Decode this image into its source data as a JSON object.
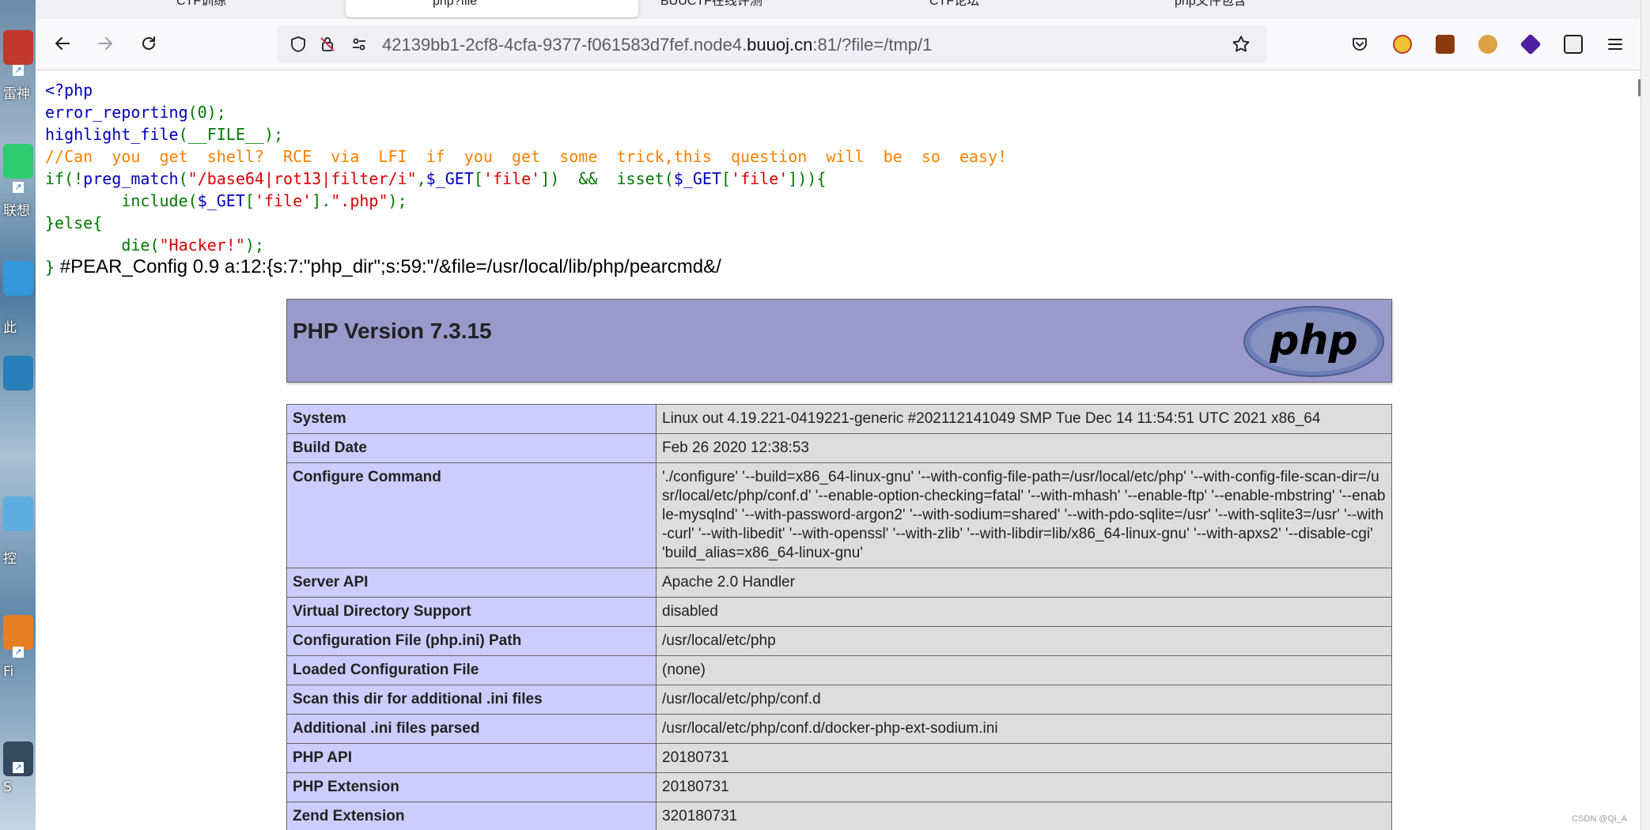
{
  "browser": {
    "tabs": [
      {
        "label": "CTF训练",
        "active": false
      },
      {
        "label": "php?file",
        "active": true
      },
      {
        "label": "BUUCTF在线评测",
        "active": false
      },
      {
        "label": "CTF论坛",
        "active": false
      },
      {
        "label": "php文件包含",
        "active": false
      }
    ],
    "url": {
      "prefix": "42139bb1-2cf8-4cfa-9377-f061583d7fef.node4.",
      "host": "buuoj.cn",
      "suffix": ":81/?file=/tmp/1"
    },
    "icons": {
      "back": "arrow-left-icon",
      "forward": "arrow-right-icon",
      "reload": "reload-icon",
      "shield": "shield-icon",
      "tracking": "tracking-blocked-icon",
      "permissions": "permissions-icon",
      "bookmark": "star-icon",
      "pocket": "pocket-icon",
      "menu": "hamburger-icon"
    }
  },
  "desktop": {
    "labels": [
      "雷神",
      "联想",
      "此",
      "控",
      "Fi",
      "S"
    ]
  },
  "source_code": {
    "line1": "<?php",
    "line2_fn": "error_reporting",
    "line2_rest": "(0);",
    "line3_fn": "highlight_file",
    "line3_rest": "(__FILE__);",
    "line4_comment": "//Can  you  get  shell?  RCE  via  LFI  if  you  get  some  trick,this  question  will  be  so  easy!",
    "line5_if": "if(!",
    "line5_fn": "preg_match",
    "line5_a": "(",
    "line5_pattern": "\"/base64|rot13|filter/i\"",
    "line5_b": ",",
    "line5_var1": "$_GET",
    "line5_c": "[",
    "line5_key1": "'file'",
    "line5_d": "])  &&  ",
    "line5_isset": "isset",
    "line5_e": "(",
    "line5_var2": "$_GET",
    "line5_f": "[",
    "line5_key2": "'file'",
    "line5_g": "])){",
    "line6_indent": "        ",
    "line6_include": "include(",
    "line6_var": "$_GET",
    "line6_a": "[",
    "line6_key": "'file'",
    "line6_b": "].",
    "line6_ext": "\".php\"",
    "line6_c": ");",
    "line7": "}else{",
    "line8_indent": "        ",
    "line8_die": "die(",
    "line8_msg": "\"Hacker!\"",
    "line8_end": ");",
    "line9_brace": "}",
    "line9_pear": " #PEAR_Config 0.9 a:12:{s:7:\"php_dir\";s:59:\"/&file=/usr/local/lib/php/pearcmd&/"
  },
  "phpinfo": {
    "title": "PHP Version 7.3.15",
    "logo_text": "php",
    "rows": [
      {
        "key": "System",
        "value": "Linux out 4.19.221-0419221-generic #202112141049 SMP Tue Dec 14 11:54:51 UTC 2021 x86_64"
      },
      {
        "key": "Build Date",
        "value": "Feb 26 2020 12:38:53"
      },
      {
        "key": "Configure Command",
        "value": "'./configure' '--build=x86_64-linux-gnu' '--with-config-file-path=/usr/local/etc/php' '--with-config-file-scan-dir=/usr/local/etc/php/conf.d' '--enable-option-checking=fatal' '--with-mhash' '--enable-ftp' '--enable-mbstring' '--enable-mysqlnd' '--with-password-argon2' '--with-sodium=shared' '--with-pdo-sqlite=/usr' '--with-sqlite3=/usr' '--with-curl' '--with-libedit' '--with-openssl' '--with-zlib' '--with-libdir=lib/x86_64-linux-gnu' '--with-apxs2' '--disable-cgi' 'build_alias=x86_64-linux-gnu'"
      },
      {
        "key": "Server API",
        "value": "Apache 2.0 Handler"
      },
      {
        "key": "Virtual Directory Support",
        "value": "disabled"
      },
      {
        "key": "Configuration File (php.ini) Path",
        "value": "/usr/local/etc/php"
      },
      {
        "key": "Loaded Configuration File",
        "value": "(none)"
      },
      {
        "key": "Scan this dir for additional .ini files",
        "value": "/usr/local/etc/php/conf.d"
      },
      {
        "key": "Additional .ini files parsed",
        "value": "/usr/local/etc/php/conf.d/docker-php-ext-sodium.ini"
      },
      {
        "key": "PHP API",
        "value": "20180731"
      },
      {
        "key": "PHP Extension",
        "value": "20180731"
      },
      {
        "key": "Zend Extension",
        "value": "320180731"
      }
    ]
  },
  "watermark": "CSDN @Qi_A",
  "colors": {
    "php_header": "#9999cc",
    "key_cell": "#ccccff",
    "value_cell": "#dddddd",
    "php_default": "#0000bb",
    "php_keyword": "#007700",
    "php_string": "#dd0000",
    "php_comment": "#ff8000"
  }
}
